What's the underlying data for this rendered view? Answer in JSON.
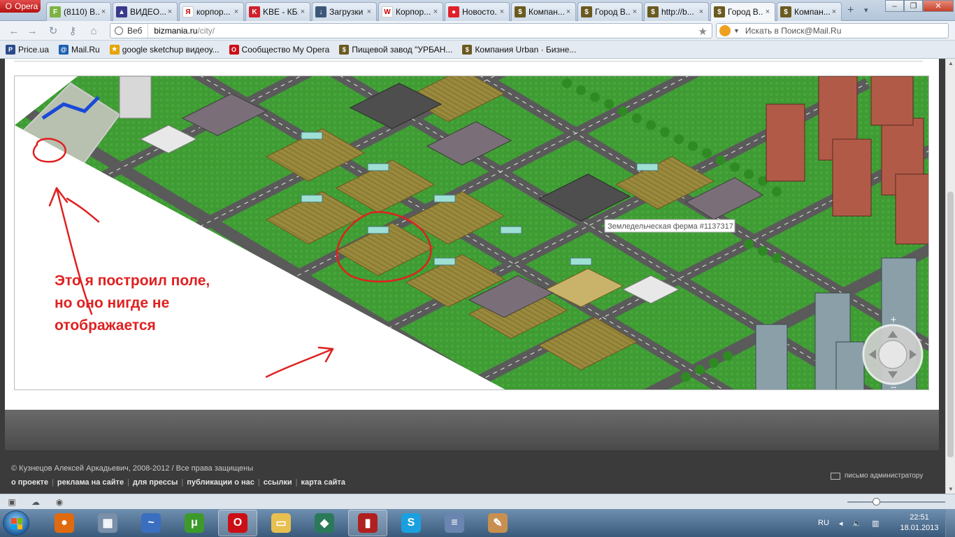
{
  "browser": {
    "menu_label": "Opera",
    "tabs": [
      {
        "title": "(8110) В...",
        "fav": "F",
        "color": "#7cb342"
      },
      {
        "title": "ВИДЕО...",
        "fav": "▲",
        "color": "#3a3a8c"
      },
      {
        "title": "корпор...",
        "fav": "Я",
        "color": "#ffffff"
      },
      {
        "title": "KBE - КБ...",
        "fav": "K",
        "color": "#d0202a"
      },
      {
        "title": "Загрузки",
        "fav": "↓",
        "color": "#3c5878"
      },
      {
        "title": "Корпор...",
        "fav": "W",
        "color": "#ffffff"
      },
      {
        "title": "Новосто...",
        "fav": "●",
        "color": "#e0202a"
      },
      {
        "title": "Компан...",
        "fav": "$",
        "color": "#6b5a20"
      },
      {
        "title": "Город В...",
        "fav": "$",
        "color": "#6b5a20"
      },
      {
        "title": "http://b...",
        "fav": "$",
        "color": "#6b5a20"
      },
      {
        "title": "Город В...",
        "fav": "$",
        "color": "#6b5a20"
      },
      {
        "title": "Компан...",
        "fav": "$",
        "color": "#6b5a20"
      }
    ],
    "active_tab": 10,
    "address": {
      "prefix": "Веб",
      "host": "bizmania.ru",
      "path": "/city/"
    },
    "search_placeholder": "Искать в Поиск@Mail.Ru",
    "bookmarks": [
      {
        "label": "Price.ua",
        "fav": "P",
        "color": "#2b4a8c"
      },
      {
        "label": "Mail.Ru",
        "fav": "@",
        "color": "#1a5fb0"
      },
      {
        "label": "google sketchup видеоу...",
        "fav": "★",
        "color": "#e6a400"
      },
      {
        "label": "Сообщество My Opera",
        "fav": "O",
        "color": "#cc0f16"
      },
      {
        "label": "Пищевой завод \"УРБАН...",
        "fav": "$",
        "color": "#6b5a20"
      },
      {
        "label": "Компания Urban · Бизне...",
        "fav": "$",
        "color": "#6b5a20"
      }
    ]
  },
  "page": {
    "tooltip": "Земледельческая ферма #1137317",
    "annotation": [
      "Это я построил поле,",
      "но оно нигде не",
      "отображается"
    ],
    "annotation_color": "#e02020",
    "footer": {
      "copyright": "© Кузнецов Алексей Аркадьевич, 2008-2012 / Все права защищены",
      "links": [
        "о проекте",
        "реклама на сайте",
        "для прессы",
        "публикации о нас",
        "ссылки",
        "карта сайта"
      ],
      "admin_mail": "письмо администратору"
    }
  },
  "taskbar": {
    "items": [
      {
        "name": "firefox",
        "color": "#e06a10",
        "glyph": "●"
      },
      {
        "name": "calculator",
        "color": "#7a8fa8",
        "glyph": "▦"
      },
      {
        "name": "chart-app",
        "color": "#3a6fc0",
        "glyph": "~"
      },
      {
        "name": "utorrent",
        "color": "#3d9a2a",
        "glyph": "μ"
      },
      {
        "name": "opera",
        "color": "#cc0f16",
        "glyph": "O"
      },
      {
        "name": "explorer",
        "color": "#e8c050",
        "glyph": "▭"
      },
      {
        "name": "game-app",
        "color": "#2a7a5a",
        "glyph": "◆"
      },
      {
        "name": "bizmania-app",
        "color": "#b02020",
        "glyph": "▮"
      },
      {
        "name": "skype",
        "color": "#1aa0e0",
        "glyph": "S"
      },
      {
        "name": "odf-viewer",
        "color": "#6a86b0",
        "glyph": "≡"
      },
      {
        "name": "paint",
        "color": "#c89050",
        "glyph": "✎"
      }
    ],
    "active_items": [
      4,
      7
    ],
    "lang": "RU",
    "time": "22:51",
    "date": "18.01.2013"
  }
}
